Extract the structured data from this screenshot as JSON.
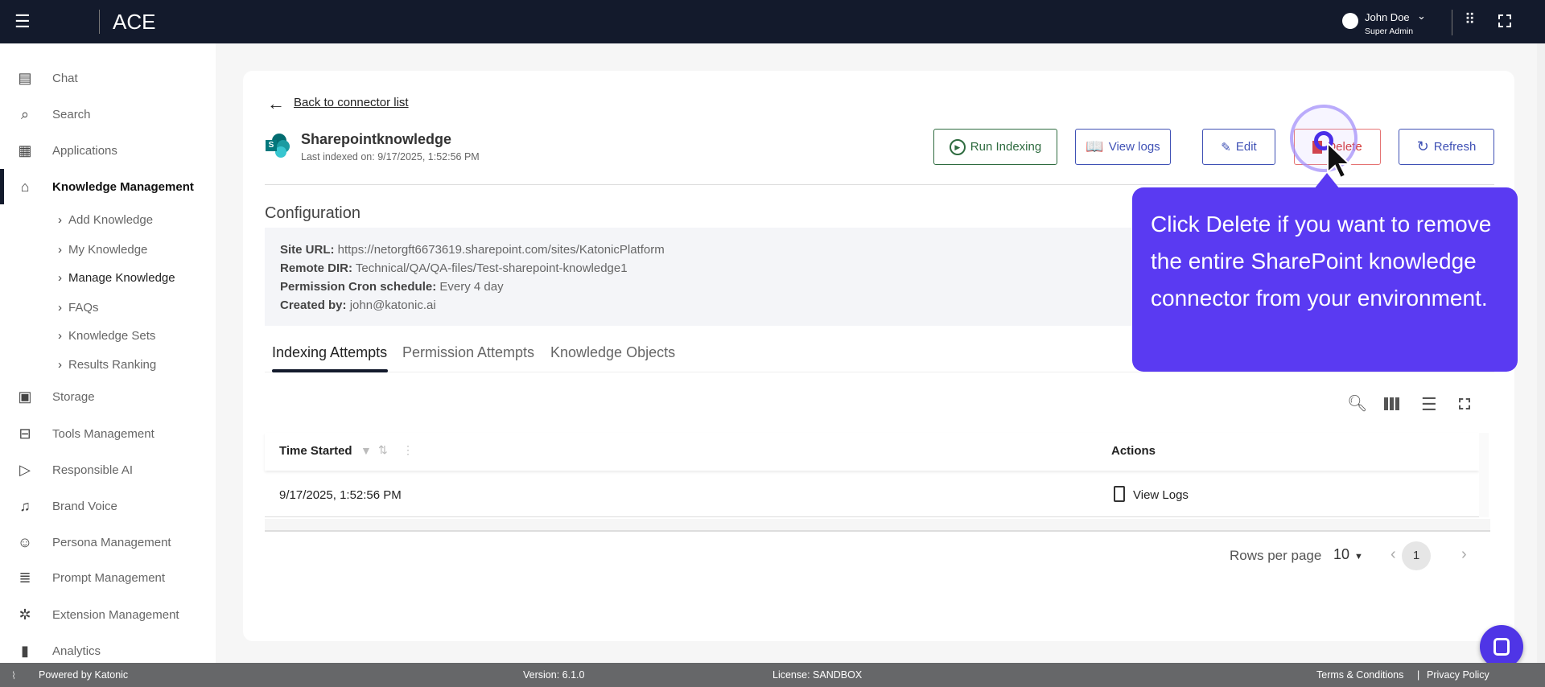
{
  "header": {
    "app_title": "ACE",
    "user_name": "John Doe",
    "user_role": "Super Admin"
  },
  "sidebar": {
    "items": [
      {
        "label": "Chat",
        "icon": "chat-icon"
      },
      {
        "label": "Search",
        "icon": "search-list-icon"
      },
      {
        "label": "Applications",
        "icon": "grid-icon"
      },
      {
        "label": "Knowledge Management",
        "icon": "graduation-cap-icon"
      },
      {
        "label": "Storage",
        "icon": "storage-icon"
      },
      {
        "label": "Tools Management",
        "icon": "toolbox-icon"
      },
      {
        "label": "Responsible AI",
        "icon": "video-settings-icon"
      },
      {
        "label": "Brand Voice",
        "icon": "voice-icon"
      },
      {
        "label": "Persona Management",
        "icon": "persona-icon"
      },
      {
        "label": "Prompt Management",
        "icon": "prompt-icon"
      },
      {
        "label": "Extension Management",
        "icon": "puzzle-icon"
      },
      {
        "label": "Analytics",
        "icon": "bar-chart-icon"
      }
    ],
    "sub_items": [
      "Add Knowledge",
      "My Knowledge",
      "Manage Knowledge",
      "FAQs",
      "Knowledge Sets",
      "Results Ranking"
    ]
  },
  "page": {
    "back_link": "Back to connector list",
    "title": "Sharepointknowledge",
    "last_indexed": "Last indexed on: 9/17/2025, 1:52:56 PM",
    "buttons": {
      "run": "Run Indexing",
      "logs": "View logs",
      "edit": "Edit",
      "delete": "Delete",
      "refresh": "Refresh"
    },
    "config_heading": "Configuration",
    "config": [
      {
        "label": "Site URL:",
        "value": "https://netorgft6673619.sharepoint.com/sites/KatonicPlatform"
      },
      {
        "label": "Remote DIR:",
        "value": "Technical/QA/QA-files/Test-sharepoint-knowledge1"
      },
      {
        "label": "Permission Cron schedule:",
        "value": "Every 4 day"
      },
      {
        "label": "Created by:",
        "value": "john@katonic.ai"
      }
    ],
    "tabs": [
      "Indexing Attempts",
      "Permission Attempts",
      "Knowledge Objects"
    ],
    "table": {
      "columns": [
        "Time Started",
        "Actions"
      ],
      "rows": [
        {
          "time": "9/17/2025, 1:52:56 PM",
          "action": "View Logs"
        }
      ]
    },
    "pagination": {
      "rows_label": "Rows per page",
      "rows_value": "10",
      "page": "1"
    }
  },
  "tooltip": "Click Delete if you want to remove the entire SharePoint knowledge connector from your environment.",
  "footer": {
    "powered": "Powered by Katonic",
    "version": "Version: 6.1.0",
    "license": "License: SANDBOX",
    "terms": "Terms & Conditions",
    "sep": "|",
    "privacy": "Privacy Policy"
  },
  "colors": {
    "header": "#131a2c",
    "accent": "#3f51b5",
    "tooltip": "#5a3af2",
    "delete": "#d32f2f",
    "run": "#2e6b3f"
  }
}
